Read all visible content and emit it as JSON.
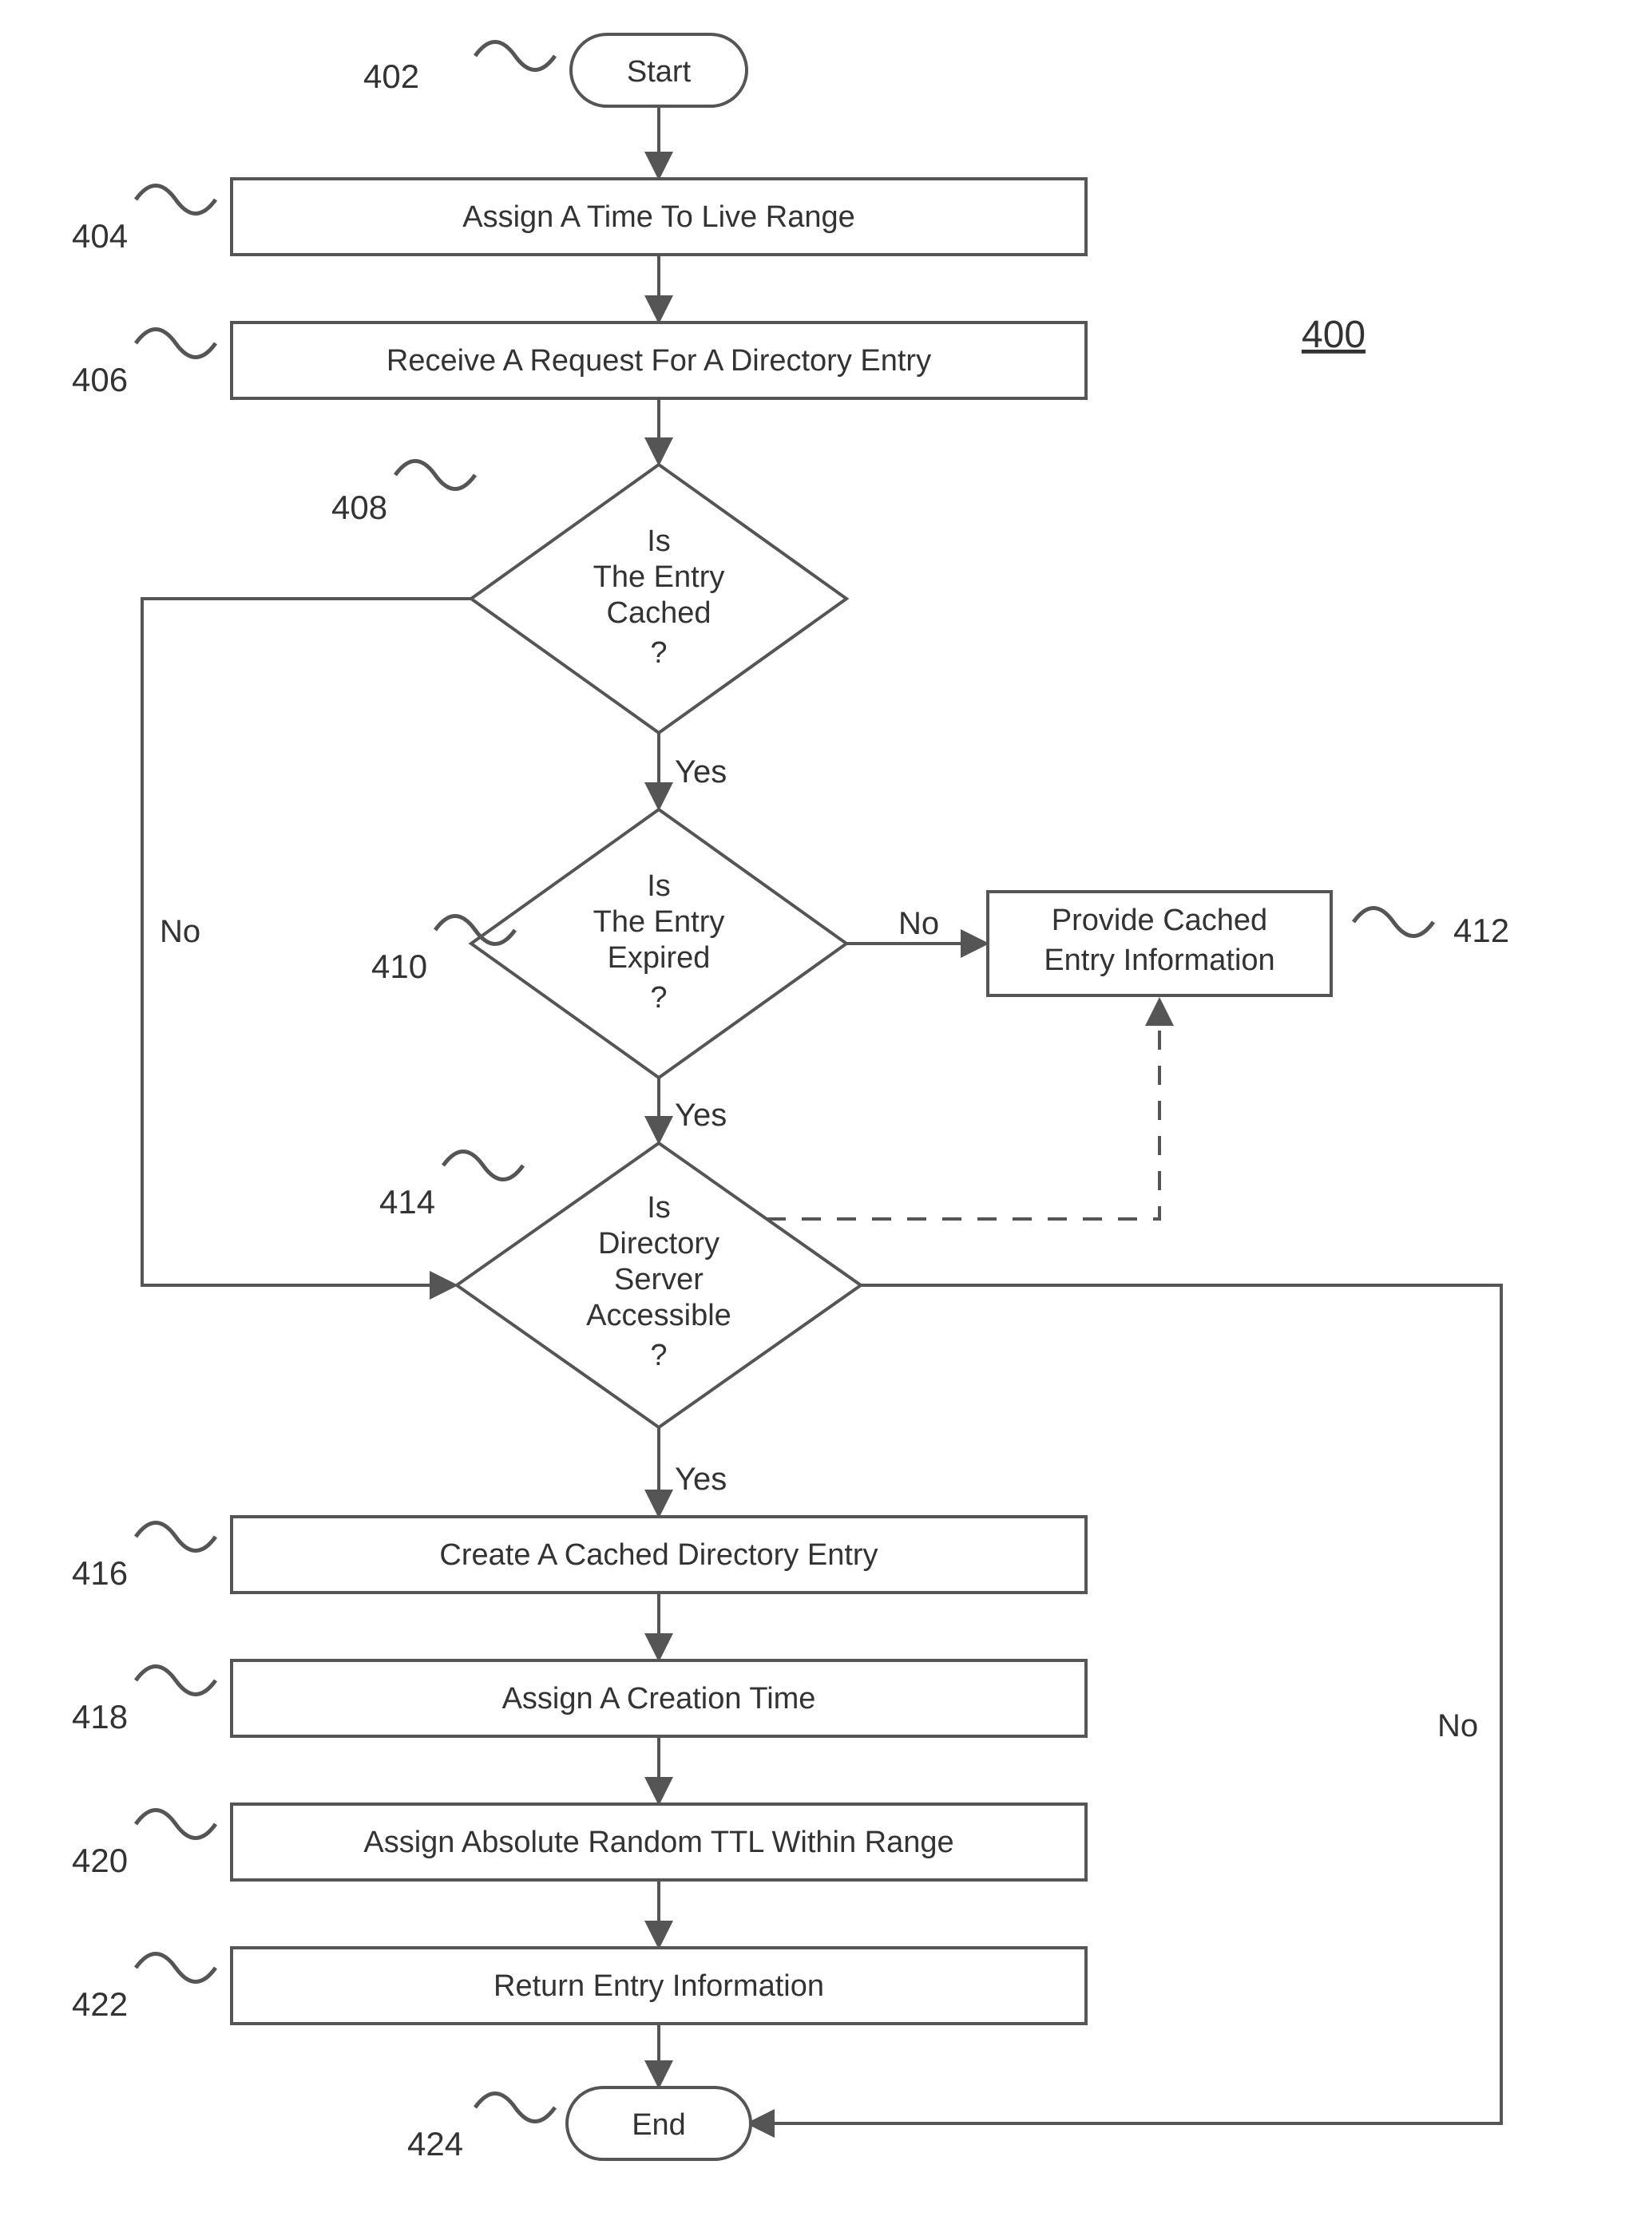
{
  "figure_ref": "400",
  "nodes": {
    "start": {
      "label": "Start",
      "ref": "402"
    },
    "assign_ttl_range": {
      "label": "Assign A Time To Live Range",
      "ref": "404"
    },
    "receive_request": {
      "label": "Receive A Request For A Directory Entry",
      "ref": "406"
    },
    "is_cached": {
      "lines": [
        "Is",
        "The Entry",
        "Cached",
        "?"
      ],
      "ref": "408"
    },
    "is_expired": {
      "lines": [
        "Is",
        "The Entry",
        "Expired",
        "?"
      ],
      "ref": "410"
    },
    "provide_cached": {
      "lines": [
        "Provide Cached",
        "Entry Information"
      ],
      "ref": "412"
    },
    "is_accessible": {
      "lines": [
        "Is",
        "Directory",
        "Server",
        "Accessible",
        "?"
      ],
      "ref": "414"
    },
    "create_cached": {
      "label": "Create A Cached Directory Entry",
      "ref": "416"
    },
    "assign_creation": {
      "label": "Assign A Creation Time",
      "ref": "418"
    },
    "assign_random": {
      "label": "Assign Absolute Random TTL Within Range",
      "ref": "420"
    },
    "return_info": {
      "label": "Return Entry Information",
      "ref": "422"
    },
    "end": {
      "label": "End",
      "ref": "424"
    }
  },
  "edges": {
    "cached_yes": "Yes",
    "cached_no": "No",
    "expired_yes": "Yes",
    "expired_no": "No",
    "accessible_yes": "Yes",
    "accessible_no": "No"
  }
}
